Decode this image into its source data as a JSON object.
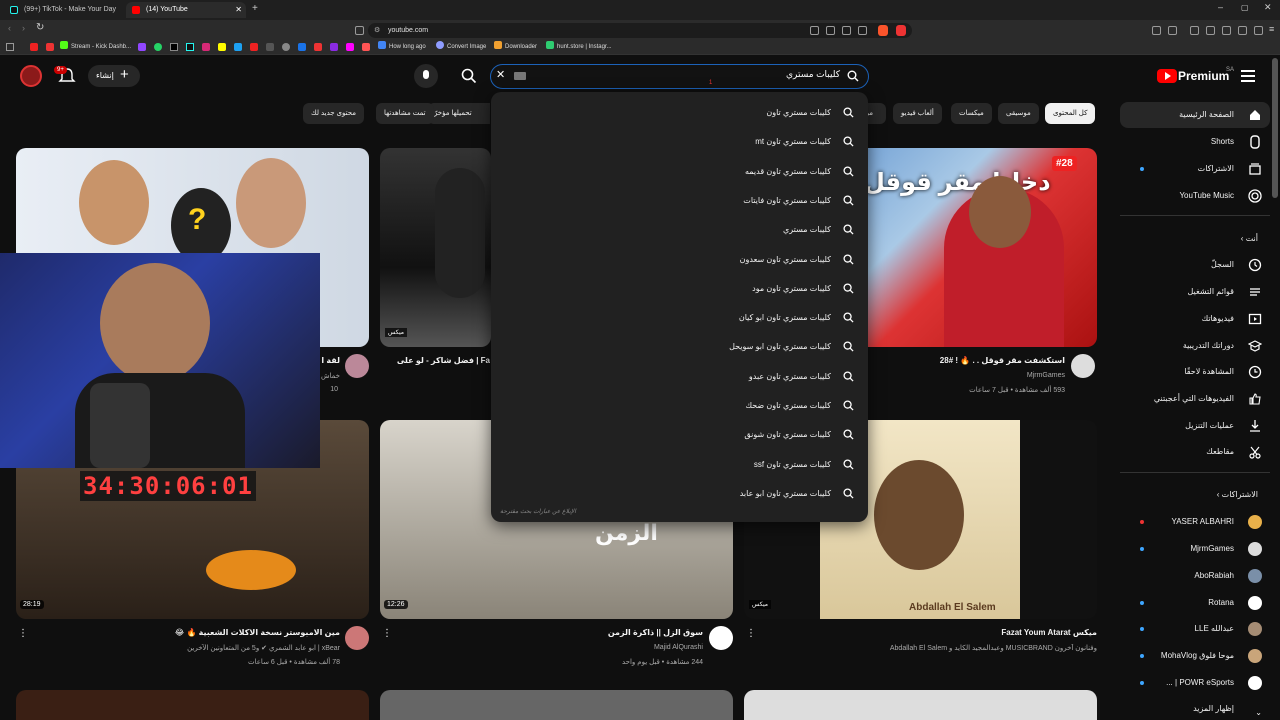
{
  "browser": {
    "tabs": [
      {
        "label": "(99+) TikTok - Make Your Day"
      },
      {
        "label": "(14) YouTube"
      }
    ],
    "url": "youtube.com",
    "bookmarks": [
      "Stream - Kick Dashb...",
      "How long ago",
      "Convert Image",
      "Downloader",
      "hunt.store | Instagr..."
    ]
  },
  "header": {
    "logo": "Premium",
    "region": "SA",
    "create_label": "إنشاء",
    "notif_count": "9+",
    "search_value": "كليبات مستري",
    "search_badge": "1"
  },
  "chips": [
    {
      "label": "كل المحتوى"
    },
    {
      "label": "موسيقى"
    },
    {
      "label": "ميكسات"
    },
    {
      "label": "ألعاب فيديو"
    },
    {
      "label": "مبا"
    },
    {
      "label": "تحميلها مؤخرًا"
    },
    {
      "label": "تمت مشاهدتها"
    },
    {
      "label": "محتوى جديد لك"
    }
  ],
  "suggestions": [
    "كليبات مستري تاون",
    "كليبات مستري تاون mt",
    "كليبات مستري تاون قديمه",
    "كليبات مستري تاون فايتات",
    "كليبات مستري",
    "كليبات مستري تاون سعدون",
    "كليبات مستري تاون مود",
    "كليبات مستري تاون ابو كيان",
    "كليبات مستري تاون ابو سويحل",
    "كليبات مستري تاون عبدو",
    "كليبات مستري تاون ضحك",
    "كليبات مستري تاون شونق",
    "كليبات مستري تاون ssf",
    "كليبات مستري تاون ابو عابد"
  ],
  "suggestions_footer": "الإبلاغ عن عبارات بحث مقترحة",
  "sidebar": {
    "main": [
      {
        "label": "الصفحة الرئيسية"
      },
      {
        "label": "Shorts"
      },
      {
        "label": "الاشتراكات"
      },
      {
        "label": "YouTube Music"
      }
    ],
    "you_title": "أنت",
    "you": [
      {
        "label": "السجلّ"
      },
      {
        "label": "قوائم التشغيل"
      },
      {
        "label": "فيديوهاتك"
      },
      {
        "label": "دوراتك التدريبية"
      },
      {
        "label": "المشاهدة لاحقًا"
      },
      {
        "label": "الفيديوهات التي أعجبتني"
      },
      {
        "label": "عمليات التنزيل"
      },
      {
        "label": "مقاطعك"
      }
    ],
    "subs_title": "الاشتراكات",
    "subs": [
      {
        "label": "YASER ALBAHRI",
        "color": "#e8b04a"
      },
      {
        "label": "MjrmGames",
        "color": "#dcdcdc"
      },
      {
        "label": "AboRabiah",
        "color": "#7a8fa8"
      },
      {
        "label": "Rotana",
        "color": "#ffffff"
      },
      {
        "label": "عبدالله LLE",
        "color": "#a58c74"
      },
      {
        "label": "موحا فلوق MohaVlog",
        "color": "#c9a57a"
      },
      {
        "label": "POWR eSports | ...",
        "color": "#ffffff"
      }
    ],
    "show_more": "إظهار المزيد"
  },
  "cards": [
    {
      "title": "استكشفت مقر قوقل . . 🔥 ! #28",
      "channel": "MjrmGames",
      "meta": "593 ألف مشاهدة • قبل 7 ساعات",
      "thumb_text": "دخلنا مقر قوقل",
      "badge": "#28"
    },
    {
      "title": "Fa | فضل شاكر - لو على",
      "channel": "",
      "meta": "",
      "mix": "ميكس"
    },
    {
      "title": "لقة ال",
      "channel": "خماش",
      "meta": "10"
    },
    {
      "title": "ميكس Fazat Youm Atarat",
      "channel": "وفنانون آخرون MUSICBRAND وعبدالمجيد الكايد و Abdallah El Salem",
      "meta": "",
      "thumb_text": "Abdallah El Salem",
      "mix": "ميكس"
    },
    {
      "title": "سوق الزل || ذاكرة الزمن",
      "channel": "Majid AlQurashi",
      "meta": "244 مشاهدة • قبل يوم واحد",
      "duration": "12:26",
      "thumb_text": "الزمن"
    },
    {
      "title": "مين الامبوستر نسخة الاكلات الشعبية 🔥 😂",
      "channel": "xBear | ابو عابد الشمري ✔ و5 من المتعاونين الآخرين",
      "meta": "78 ألف مشاهدة • قبل 6 ساعات",
      "duration": "28:19"
    }
  ],
  "overlay": {
    "timer": "34:30:06:01"
  }
}
